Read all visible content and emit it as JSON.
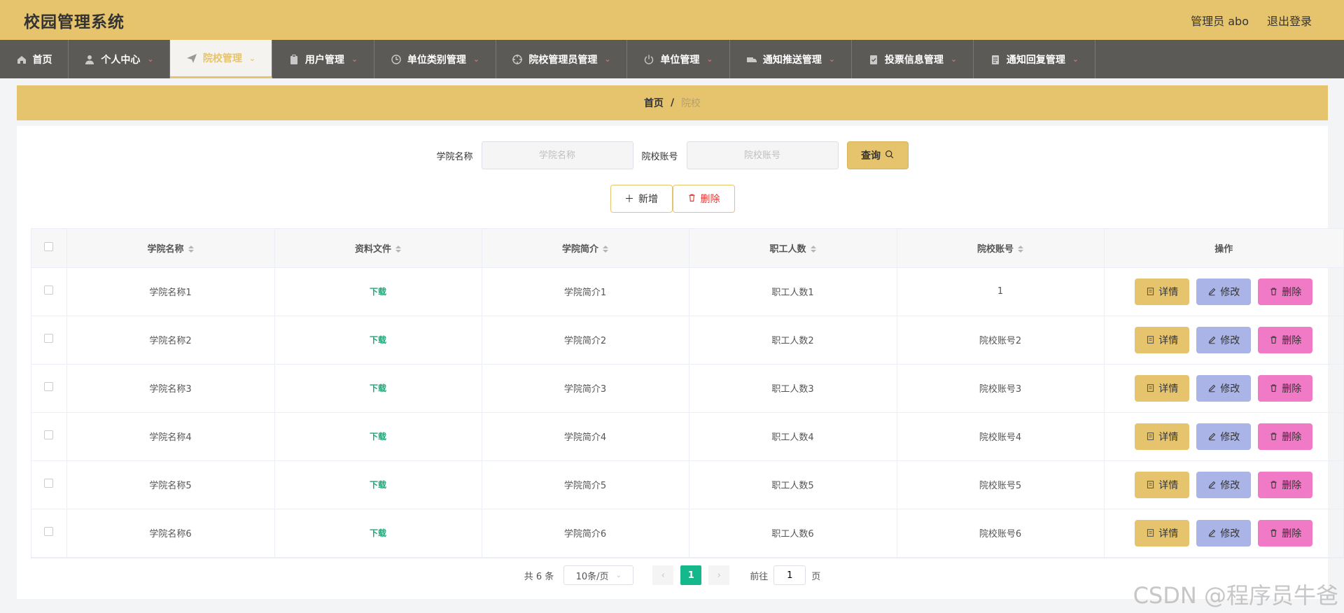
{
  "app": {
    "title": "校园管理系统"
  },
  "header": {
    "user": "管理员 abo",
    "logout": "退出登录"
  },
  "nav": {
    "items": [
      {
        "label": "首页",
        "icon": "home-icon",
        "caret": false
      },
      {
        "label": "个人中心",
        "icon": "user-icon",
        "caret": true
      },
      {
        "label": "院校管理",
        "icon": "send-icon",
        "caret": true,
        "active": true
      },
      {
        "label": "用户管理",
        "icon": "clipboard-icon",
        "caret": true
      },
      {
        "label": "单位类别管理",
        "icon": "clock-icon",
        "caret": true
      },
      {
        "label": "院校管理员管理",
        "icon": "target-icon",
        "caret": true
      },
      {
        "label": "单位管理",
        "icon": "power-icon",
        "caret": true
      },
      {
        "label": "通知推送管理",
        "icon": "truck-icon",
        "caret": true
      },
      {
        "label": "投票信息管理",
        "icon": "checklist-icon",
        "caret": true
      },
      {
        "label": "通知回复管理",
        "icon": "document-icon",
        "caret": true
      }
    ]
  },
  "breadcrumb": {
    "home": "首页",
    "sep": "/",
    "current": "院校"
  },
  "search": {
    "name_label": "学院名称",
    "name_placeholder": "学院名称",
    "account_label": "院校账号",
    "account_placeholder": "院校账号",
    "query_label": "查询"
  },
  "actions": {
    "add_label": "新增",
    "delete_label": "删除"
  },
  "table": {
    "columns": [
      "学院名称",
      "资料文件",
      "学院简介",
      "职工人数",
      "院校账号",
      "操作"
    ],
    "rows": [
      {
        "name": "学院名称1",
        "file": "下载",
        "intro": "学院简介1",
        "staff": "职工人数1",
        "account": "1"
      },
      {
        "name": "学院名称2",
        "file": "下载",
        "intro": "学院简介2",
        "staff": "职工人数2",
        "account": "院校账号2"
      },
      {
        "name": "学院名称3",
        "file": "下载",
        "intro": "学院简介3",
        "staff": "职工人数3",
        "account": "院校账号3"
      },
      {
        "name": "学院名称4",
        "file": "下载",
        "intro": "学院简介4",
        "staff": "职工人数4",
        "account": "院校账号4"
      },
      {
        "name": "学院名称5",
        "file": "下载",
        "intro": "学院简介5",
        "staff": "职工人数5",
        "account": "院校账号5"
      },
      {
        "name": "学院名称6",
        "file": "下载",
        "intro": "学院简介6",
        "staff": "职工人数6",
        "account": "院校账号6"
      }
    ],
    "op": {
      "detail": "详情",
      "edit": "修改",
      "remove": "删除"
    }
  },
  "pagination": {
    "total": "共 6 条",
    "page_size": "10条/页",
    "current_page": "1",
    "goto_prefix": "前往",
    "goto_value": "1",
    "goto_suffix": "页"
  },
  "watermark": "CSDN @程序员牛爸",
  "colors": {
    "accent": "#e6c46e",
    "nav": "#5c5a57",
    "edit": "#aab4e6",
    "remove": "#f07ac5",
    "download": "#1fa67a",
    "page": "#14b88a"
  }
}
